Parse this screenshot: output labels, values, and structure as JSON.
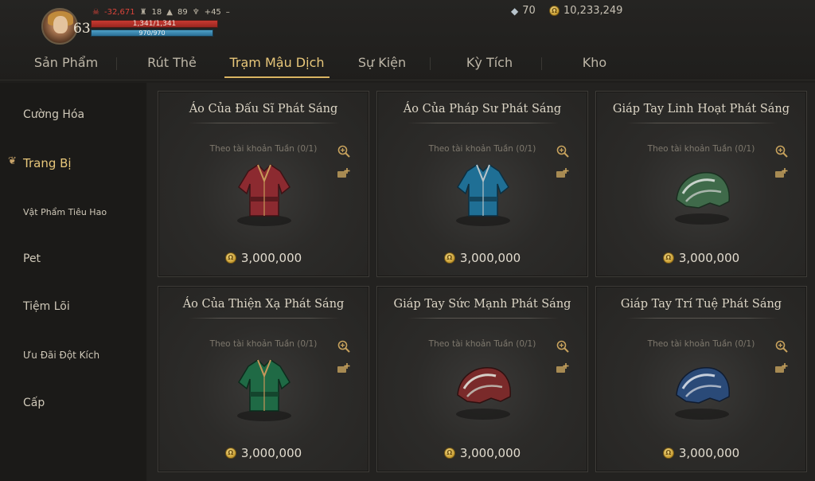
{
  "player": {
    "level": "63",
    "power": "-32,671",
    "stat_a": "18",
    "stat_b": "89",
    "stat_c": "+45",
    "hp": "1,341/1,341",
    "mp": "970/970"
  },
  "currency": {
    "gems": "70",
    "gold": "10,233,249"
  },
  "tabs": [
    {
      "label": "Sản Phẩm"
    },
    {
      "label": "Rút Thẻ"
    },
    {
      "label": "Trạm Mậu Dịch",
      "active": true
    },
    {
      "label": "Sự Kiện"
    },
    {
      "label": "Kỳ Tích"
    },
    {
      "label": "Kho"
    }
  ],
  "sidebar": {
    "items": [
      {
        "label": "Cường Hóa"
      },
      {
        "label": "Trang Bị",
        "active": true
      },
      {
        "label": "Vật Phẩm Tiêu Hao"
      },
      {
        "label": "Pet"
      },
      {
        "label": "Tiệm Lõi"
      },
      {
        "label": "Ưu Đãi Đột Kích"
      },
      {
        "label": "Cấp"
      }
    ]
  },
  "cards": [
    {
      "title": "Áo Của Đấu Sĩ Phát Sáng",
      "limit": "Theo tài khoản Tuần (0/1)",
      "price": "3,000,000",
      "item_icon": "red-robe-icon",
      "color": "#8c2a30"
    },
    {
      "title": "Áo Của Pháp Sư Phát Sáng",
      "limit": "Theo tài khoản Tuần (0/1)",
      "price": "3,000,000",
      "item_icon": "blue-robe-icon",
      "color": "#1f6f95"
    },
    {
      "title": "Giáp Tay Linh Hoạt Phát Sáng",
      "limit": "Theo tài khoản Tuần (0/1)",
      "price": "3,000,000",
      "item_icon": "green-gauntlet-icon",
      "color": "#3f6a4a"
    },
    {
      "title": "Áo Của Thiện Xạ Phát Sáng",
      "limit": "Theo tài khoản Tuần (0/1)",
      "price": "3,000,000",
      "item_icon": "green-robe-icon",
      "color": "#1f6a45"
    },
    {
      "title": "Giáp Tay Sức Mạnh Phát Sáng",
      "limit": "Theo tài khoản Tuần (0/1)",
      "price": "3,000,000",
      "item_icon": "red-gauntlet-icon",
      "color": "#7a2a2a"
    },
    {
      "title": "Giáp Tay Trí Tuệ Phát Sáng",
      "limit": "Theo tài khoản Tuần (0/1)",
      "price": "3,000,000",
      "item_icon": "blue-gauntlet-icon",
      "color": "#2a4a78"
    }
  ]
}
